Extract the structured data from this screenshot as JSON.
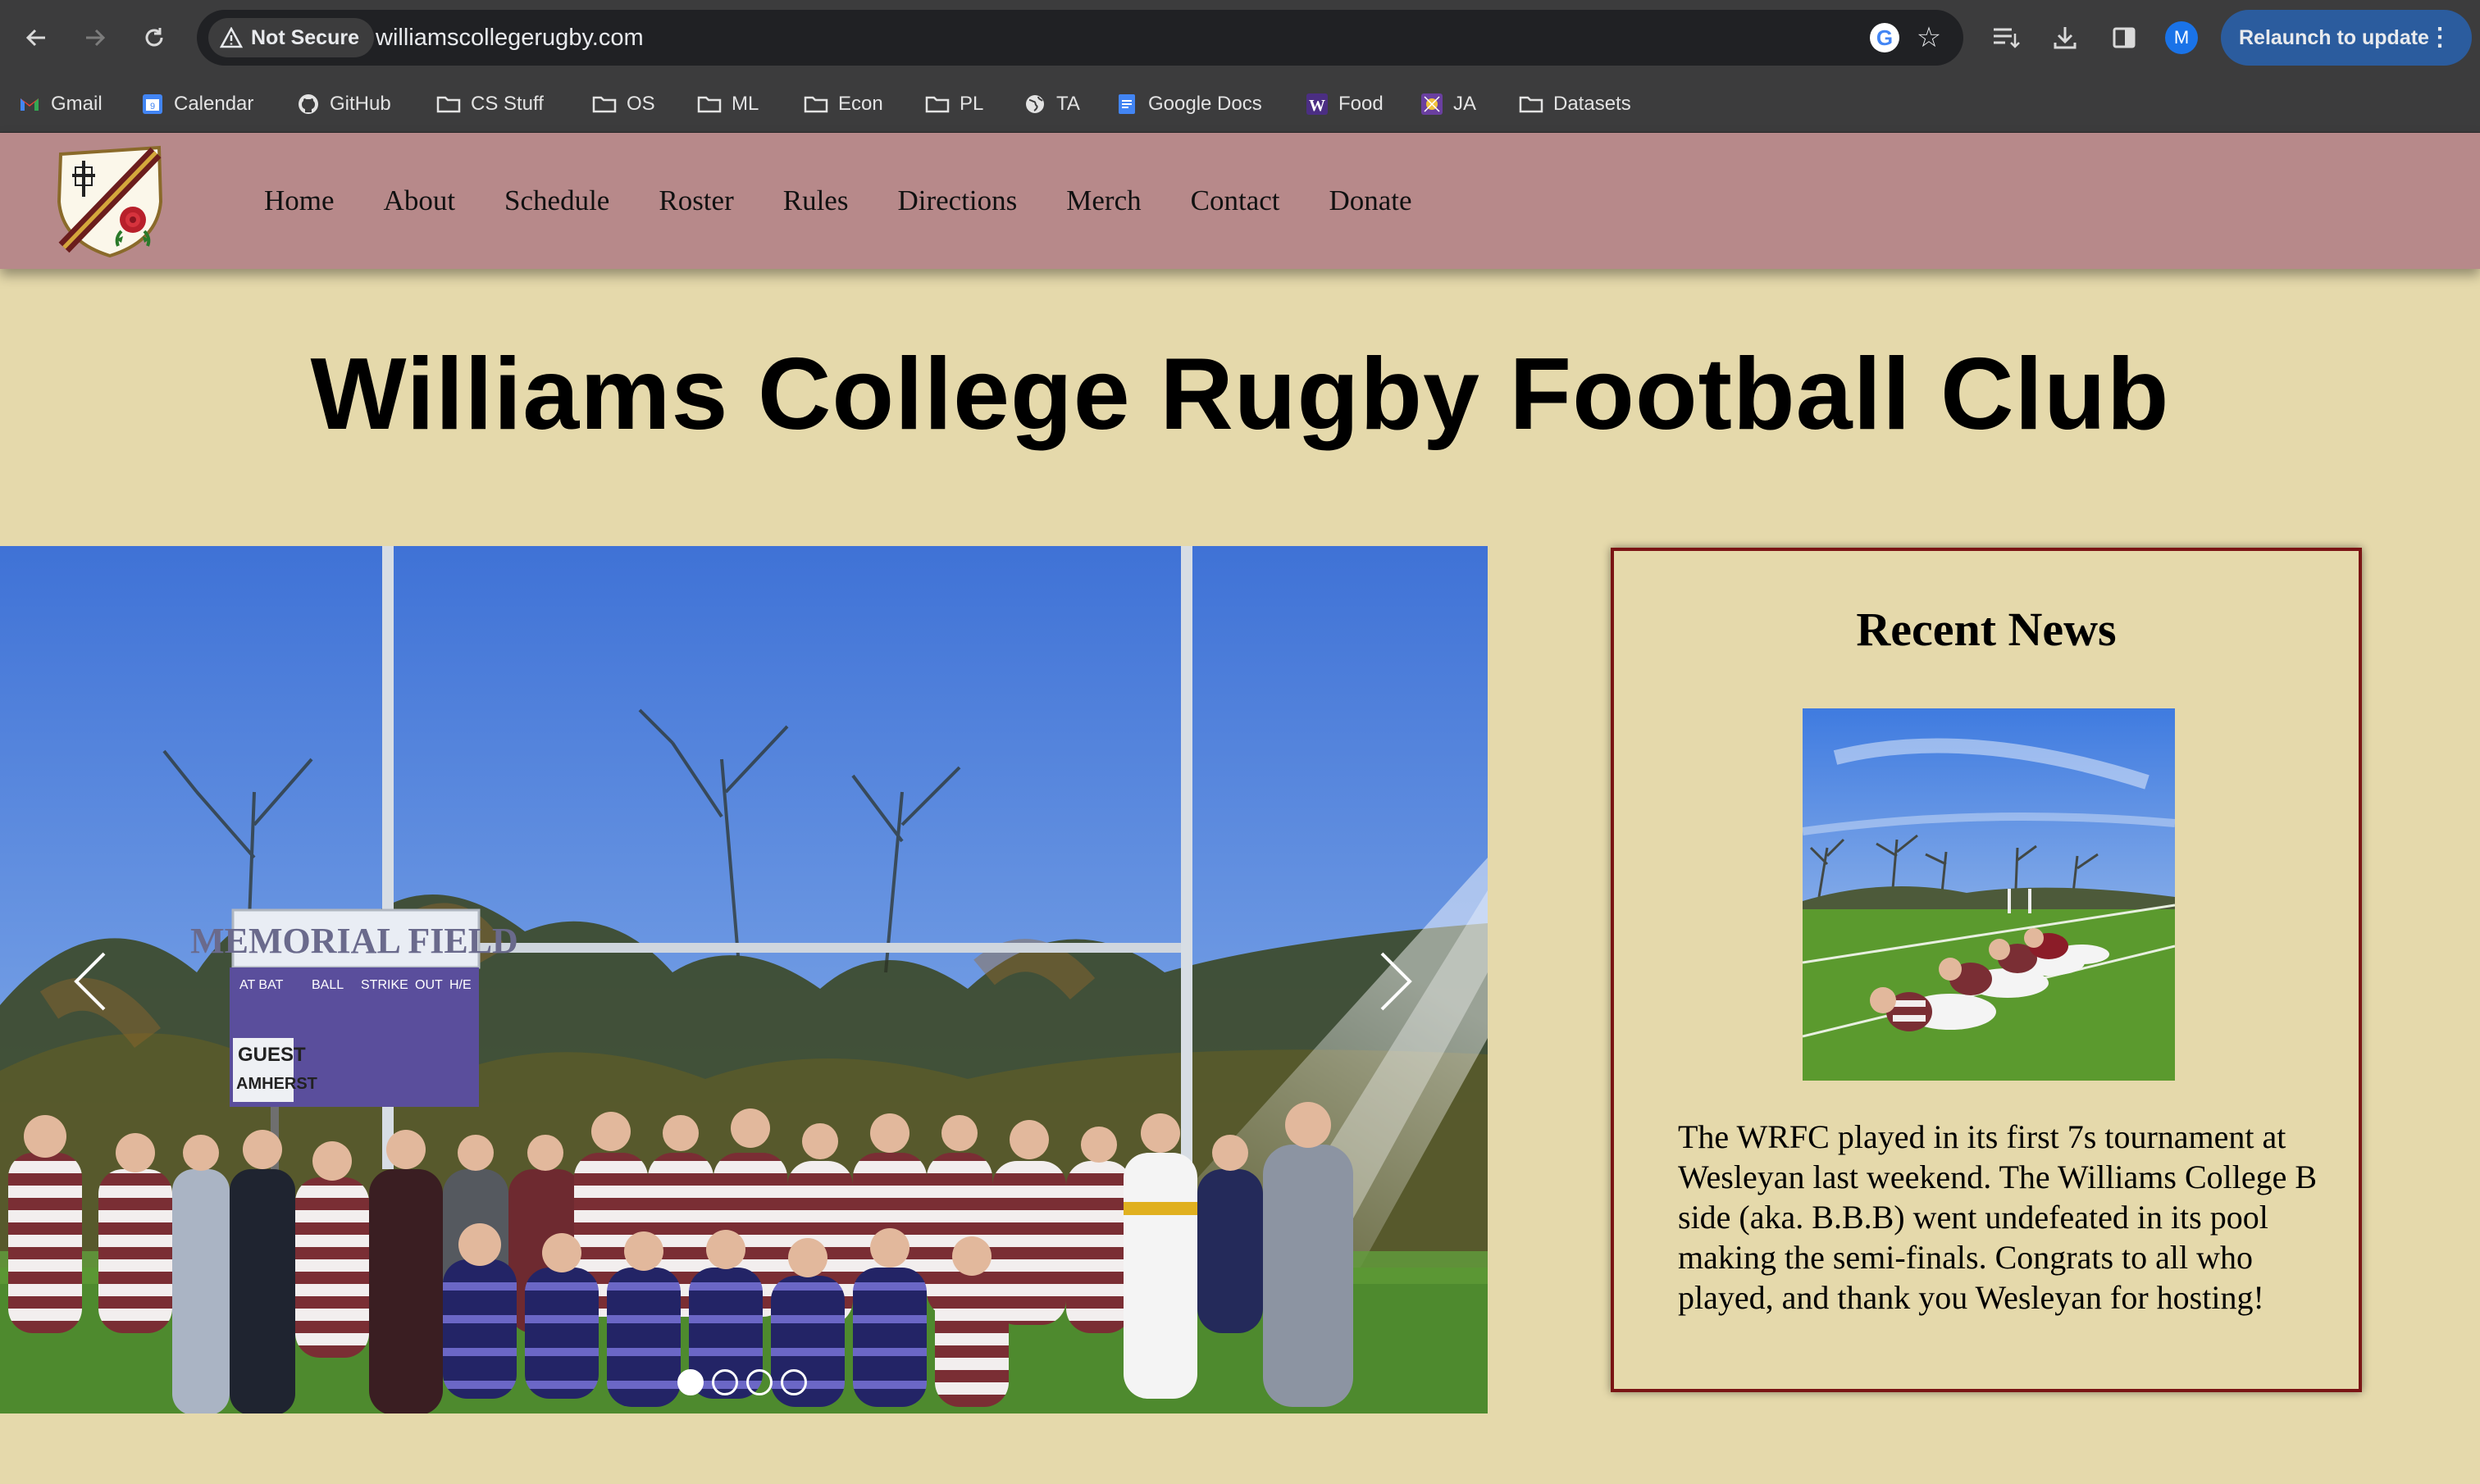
{
  "browser": {
    "security_label": "Not Secure",
    "url": "williamscollegerugby.com",
    "profile_initial": "M",
    "relaunch_label": "Relaunch to update",
    "bookmarks": [
      {
        "label": "Gmail",
        "icon": "gmail-icon"
      },
      {
        "label": "Calendar",
        "icon": "calendar-icon"
      },
      {
        "label": "GitHub",
        "icon": "github-icon"
      },
      {
        "label": "CS Stuff",
        "icon": "folder-icon"
      },
      {
        "label": "OS",
        "icon": "folder-icon"
      },
      {
        "label": "ML",
        "icon": "folder-icon"
      },
      {
        "label": "Econ",
        "icon": "folder-icon"
      },
      {
        "label": "PL",
        "icon": "folder-icon"
      },
      {
        "label": "TA",
        "icon": "globe-icon"
      },
      {
        "label": "Google Docs",
        "icon": "docs-icon"
      },
      {
        "label": "Food",
        "icon": "w-icon"
      },
      {
        "label": "JA",
        "icon": "ja-icon"
      },
      {
        "label": "Datasets",
        "icon": "folder-icon"
      }
    ]
  },
  "site": {
    "nav": [
      "Home",
      "About",
      "Schedule",
      "Roster",
      "Rules",
      "Directions",
      "Merch",
      "Contact",
      "Donate"
    ],
    "title": "Williams College Rugby Football Club",
    "carousel": {
      "slide_count": 4,
      "active_index": 0
    },
    "scoreboard": {
      "title": "MEMORIAL FIELD",
      "labels": [
        "AT BAT",
        "BALL",
        "STRIKE",
        "OUT",
        "H/E"
      ],
      "guest": "GUEST",
      "home": "AMHERST"
    },
    "news": {
      "title": "Recent News",
      "body": "The WRFC played in its first 7s tournament at Wesleyan last weekend. The Williams College B side (aka. B.B.B) went undefeated in its pool making the semi-finals. Congrats to all who played, and thank you Wesleyan for hosting!"
    }
  },
  "colors": {
    "header_bg": "#b7898a",
    "page_bg": "#e5d9ab",
    "panel_border": "#7a1414",
    "relaunch_bg": "#2b5c9e"
  }
}
